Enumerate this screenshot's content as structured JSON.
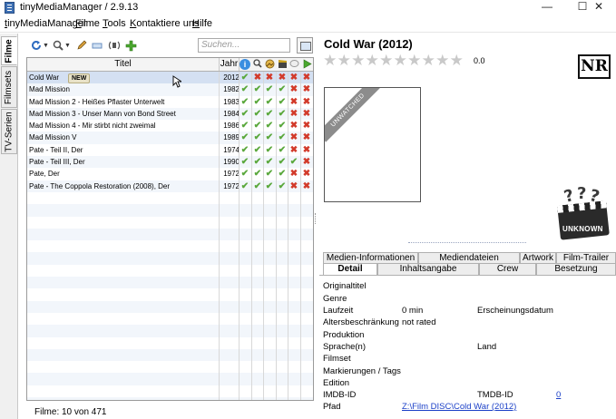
{
  "window": {
    "title": "tinyMediaManager / 2.9.13",
    "minimize": "—",
    "maximize": "☐",
    "close": "✕"
  },
  "menu": [
    "tinyMediaManager",
    "Filme",
    "Tools",
    "Kontaktiere uns",
    "Hilfe"
  ],
  "side_tabs": [
    "Filme",
    "Filmsets",
    "TV-Serien"
  ],
  "toolbar": {
    "icons": [
      "refresh-icon",
      "search-icon",
      "edit-icon",
      "rename-icon",
      "media-info-icon",
      "add-icon"
    ],
    "search_placeholder": "Suchen..."
  },
  "table": {
    "headers": {
      "title": "Titel",
      "year": "Jahr"
    },
    "header_icons": [
      "info-icon",
      "search-icon",
      "image-icon",
      "clapper-icon",
      "subtitle-icon",
      "play-icon"
    ],
    "rows": [
      {
        "title": "Cold War",
        "badge": "NEW",
        "year": "2012",
        "flags": [
          true,
          false,
          false,
          false,
          false,
          false
        ],
        "selected": true
      },
      {
        "title": "Mad Mission",
        "year": "1982",
        "flags": [
          true,
          true,
          true,
          true,
          false,
          false
        ]
      },
      {
        "title": "Mad Mission 2 - Heißes Pflaster Unterwelt",
        "year": "1983",
        "flags": [
          true,
          true,
          true,
          true,
          false,
          false
        ]
      },
      {
        "title": "Mad Mission 3 - Unser Mann von Bond Street",
        "year": "1984",
        "flags": [
          true,
          true,
          true,
          true,
          false,
          false
        ]
      },
      {
        "title": "Mad Mission 4 - Mir stirbt nicht zweimal",
        "year": "1986",
        "flags": [
          true,
          true,
          true,
          true,
          false,
          false
        ]
      },
      {
        "title": "Mad Mission V",
        "year": "1989",
        "flags": [
          true,
          true,
          true,
          true,
          false,
          false
        ]
      },
      {
        "title": "Pate - Teil II, Der",
        "year": "1974",
        "flags": [
          true,
          true,
          true,
          true,
          false,
          false
        ]
      },
      {
        "title": "Pate - Teil III, Der",
        "year": "1990",
        "flags": [
          true,
          true,
          true,
          true,
          true,
          false
        ]
      },
      {
        "title": "Pate, Der",
        "year": "1972",
        "flags": [
          true,
          true,
          true,
          true,
          false,
          false
        ]
      },
      {
        "title": "Pate -  The Coppola Restoration (2008), Der",
        "year": "1972",
        "flags": [
          true,
          true,
          true,
          true,
          false,
          false
        ]
      }
    ]
  },
  "status": "Filme: 10 von 471",
  "detail": {
    "title": "Cold War (2012)",
    "rating": "0.0",
    "certification": "NR",
    "poster_ribbon": "UNWATCHED",
    "media_badge": "UNKNOWN",
    "tabs_row1": [
      "Medien-Informationen",
      "Mediendateien",
      "Artwork",
      "Film-Trailer"
    ],
    "tabs_row2": [
      "Detail",
      "Inhaltsangabe",
      "Crew",
      "Besetzung"
    ],
    "fields": {
      "original_title": "Originaltitel",
      "genre": "Genre",
      "runtime_label": "Laufzeit",
      "runtime_value": "0  min",
      "release_label": "Erscheinungsdatum",
      "age_label": "Altersbeschränkung",
      "age_value": "not rated",
      "production": "Produktion",
      "language": "Sprache(n)",
      "country": "Land",
      "movieset": "Filmset",
      "tags": "Markierungen / Tags",
      "edition": "Edition",
      "imdb_label": "IMDB-ID",
      "tmdb_label": "TMDB-ID",
      "tmdb_value": "0",
      "path_label": "Pfad",
      "path_value": "Z:\\Film DISC\\Cold War (2012)"
    }
  },
  "colors": {
    "check": "#5aa83c",
    "cross": "#d23a2a",
    "selected_row": "#d4e0f2",
    "link": "#1a3fc7"
  }
}
